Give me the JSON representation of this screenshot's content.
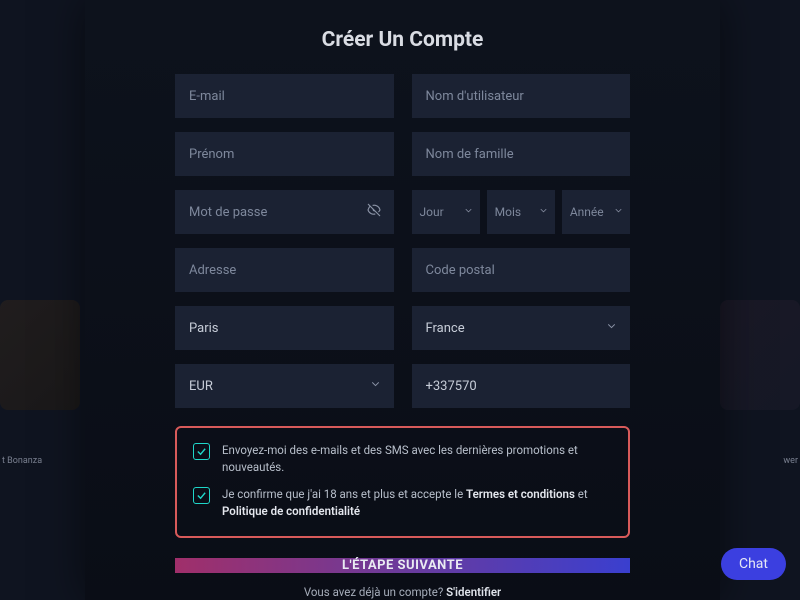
{
  "title": "Créer Un Compte",
  "fields": {
    "email_ph": "E-mail",
    "username_ph": "Nom d'utilisateur",
    "firstname_ph": "Prénom",
    "lastname_ph": "Nom de famille",
    "password_ph": "Mot de passe",
    "dob_day": "Jour",
    "dob_month": "Mois",
    "dob_year": "Année",
    "address_ph": "Adresse",
    "postal_ph": "Code postal",
    "city_val": "Paris",
    "country_val": "France",
    "currency_val": "EUR",
    "phone_val": "+337570"
  },
  "checks": {
    "promo": "Envoyez-moi des e-mails et des SMS avec les dernières promotions et nouveautés.",
    "age_pre": "Je confirme que j'ai 18 ans et plus et accepte le ",
    "terms": "Termes et conditions",
    "and": " et ",
    "privacy": "Politique de confidentialité"
  },
  "next_label": "L'ÉTAPE SUIVANTE",
  "signin": {
    "prompt": "Vous avez déjà un compte? ",
    "link": "S'identifier"
  },
  "chat_label": "Chat",
  "bg": {
    "left_label": "t Bonanza",
    "right_label": "wer"
  }
}
